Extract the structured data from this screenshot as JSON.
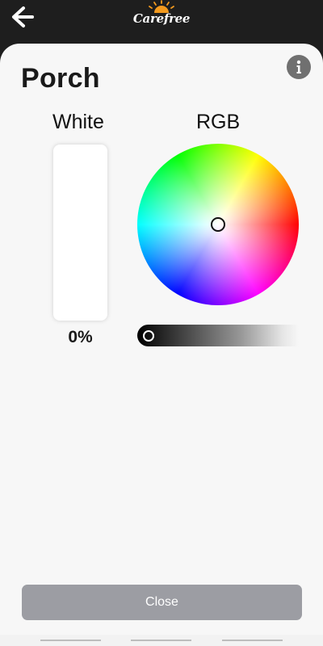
{
  "header": {
    "logo_text": "Carefree",
    "icons": {
      "back": "arrow-left-icon",
      "logo": "sun-logo-icon"
    }
  },
  "page": {
    "title": "Porch",
    "info_icon": "info-icon"
  },
  "white": {
    "label": "White",
    "value": "0%"
  },
  "rgb": {
    "label": "RGB",
    "brightness_level": 0.0
  },
  "footer": {
    "close_label": "Close"
  },
  "colors": {
    "topbar": "#1e1e1e",
    "sheet": "#f7f7f7",
    "close_button": "#9c9da3",
    "info_button": "#707070",
    "logo_sun": "#f39a1e"
  }
}
